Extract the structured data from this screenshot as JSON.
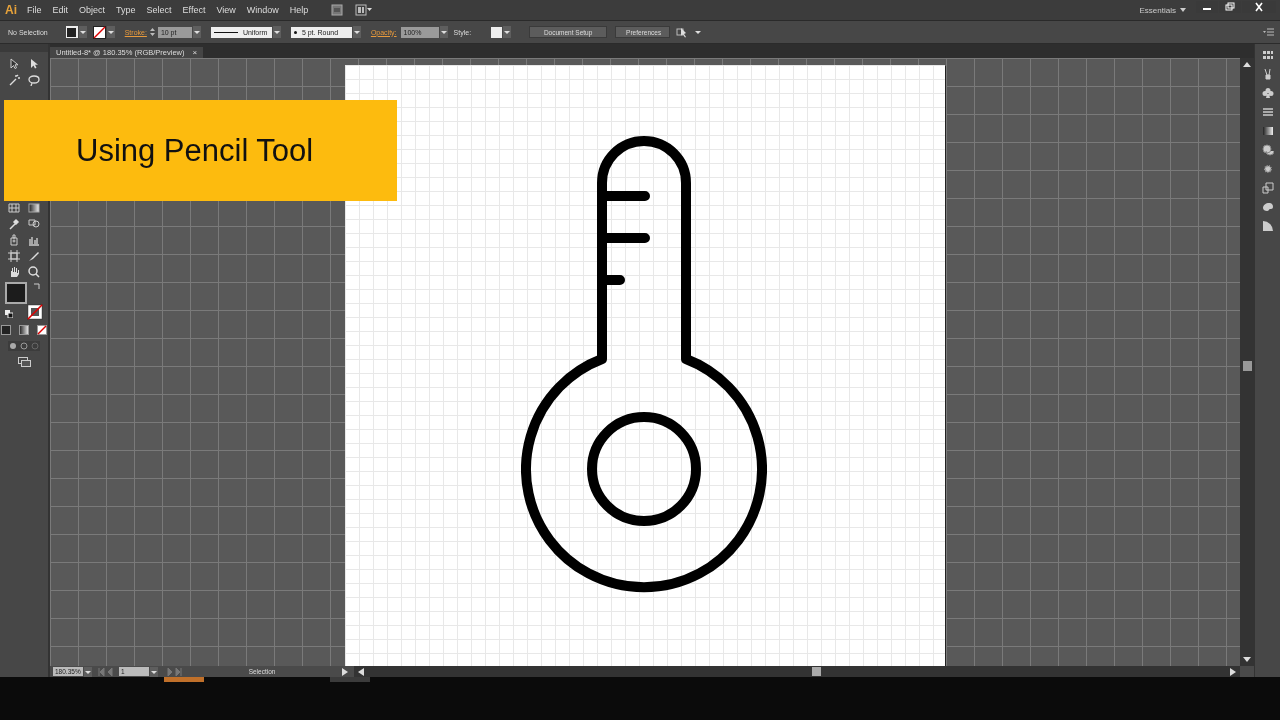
{
  "app": {
    "logo": "Ai",
    "menus": [
      "File",
      "Edit",
      "Object",
      "Type",
      "Select",
      "Effect",
      "View",
      "Window",
      "Help"
    ],
    "workspace": "Essentials"
  },
  "control_bar": {
    "selection": "No Selection",
    "stroke_label": "Stroke:",
    "stroke_weight": "10 pt",
    "stroke_profile": "Uniform",
    "brush": "5 pt. Round",
    "opacity_label": "Opacity:",
    "opacity": "100%",
    "style_label": "Style:",
    "buttons": [
      "Document Setup",
      "Preferences"
    ]
  },
  "document_tab": {
    "title": "Untitled-8* @ 180.35% (RGB/Preview)",
    "close": "×"
  },
  "overlay": {
    "title": "Using Pencil Tool"
  },
  "status_bar": {
    "zoom": "180.35%",
    "page": "1",
    "tool": "Selection"
  }
}
